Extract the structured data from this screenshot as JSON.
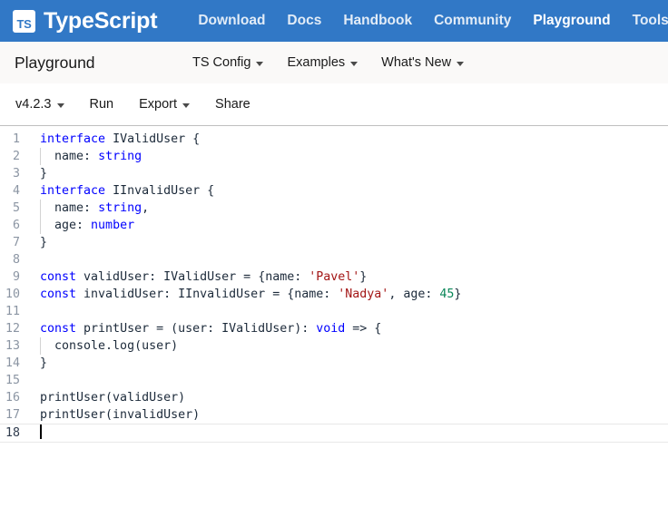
{
  "topnav": {
    "logo_text": "TS",
    "brand": "TypeScript",
    "links": [
      {
        "label": "Download",
        "active": false
      },
      {
        "label": "Docs",
        "active": false
      },
      {
        "label": "Handbook",
        "active": false
      },
      {
        "label": "Community",
        "active": false
      },
      {
        "label": "Playground",
        "active": true
      },
      {
        "label": "Tools",
        "active": false
      }
    ]
  },
  "subheader": {
    "title": "Playground",
    "menus": [
      {
        "label": "TS Config",
        "has_caret": true
      },
      {
        "label": "Examples",
        "has_caret": true
      },
      {
        "label": "What's New",
        "has_caret": true
      }
    ]
  },
  "toolbar": {
    "items": [
      {
        "label": "v4.2.3",
        "has_caret": true
      },
      {
        "label": "Run",
        "has_caret": false
      },
      {
        "label": "Export",
        "has_caret": true
      },
      {
        "label": "Share",
        "has_caret": false
      }
    ]
  },
  "editor": {
    "language": "typescript",
    "current_line": 18,
    "total_lines": 18,
    "lines": [
      {
        "n": 1,
        "indent": false,
        "tokens": [
          {
            "t": "interface",
            "c": "kw"
          },
          {
            "t": " ",
            "c": "plain"
          },
          {
            "t": "IValidUser",
            "c": "tname"
          },
          {
            "t": " {",
            "c": "plain"
          }
        ]
      },
      {
        "n": 2,
        "indent": true,
        "tokens": [
          {
            "t": "  name",
            "c": "plain"
          },
          {
            "t": ": ",
            "c": "plain"
          },
          {
            "t": "string",
            "c": "kw"
          }
        ]
      },
      {
        "n": 3,
        "indent": false,
        "tokens": [
          {
            "t": "}",
            "c": "plain"
          }
        ]
      },
      {
        "n": 4,
        "indent": false,
        "tokens": [
          {
            "t": "interface",
            "c": "kw"
          },
          {
            "t": " ",
            "c": "plain"
          },
          {
            "t": "IInvalidUser",
            "c": "tname"
          },
          {
            "t": " {",
            "c": "plain"
          }
        ]
      },
      {
        "n": 5,
        "indent": true,
        "tokens": [
          {
            "t": "  name",
            "c": "plain"
          },
          {
            "t": ": ",
            "c": "plain"
          },
          {
            "t": "string",
            "c": "kw"
          },
          {
            "t": ",",
            "c": "plain"
          }
        ]
      },
      {
        "n": 6,
        "indent": true,
        "tokens": [
          {
            "t": "  age",
            "c": "plain"
          },
          {
            "t": ": ",
            "c": "plain"
          },
          {
            "t": "number",
            "c": "kw"
          }
        ]
      },
      {
        "n": 7,
        "indent": false,
        "tokens": [
          {
            "t": "}",
            "c": "plain"
          }
        ]
      },
      {
        "n": 8,
        "indent": false,
        "tokens": []
      },
      {
        "n": 9,
        "indent": false,
        "tokens": [
          {
            "t": "const",
            "c": "kw"
          },
          {
            "t": " validUser",
            "c": "plain"
          },
          {
            "t": ": ",
            "c": "plain"
          },
          {
            "t": "IValidUser",
            "c": "tname"
          },
          {
            "t": " = {name: ",
            "c": "plain"
          },
          {
            "t": "'Pavel'",
            "c": "str"
          },
          {
            "t": "}",
            "c": "plain"
          }
        ]
      },
      {
        "n": 10,
        "indent": false,
        "tokens": [
          {
            "t": "const",
            "c": "kw"
          },
          {
            "t": " invalidUser",
            "c": "plain"
          },
          {
            "t": ": ",
            "c": "plain"
          },
          {
            "t": "IInvalidUser",
            "c": "tname"
          },
          {
            "t": " = {name: ",
            "c": "plain"
          },
          {
            "t": "'Nadya'",
            "c": "str"
          },
          {
            "t": ", age: ",
            "c": "plain"
          },
          {
            "t": "45",
            "c": "num"
          },
          {
            "t": "}",
            "c": "plain"
          }
        ]
      },
      {
        "n": 11,
        "indent": false,
        "tokens": []
      },
      {
        "n": 12,
        "indent": false,
        "tokens": [
          {
            "t": "const",
            "c": "kw"
          },
          {
            "t": " printUser = (user",
            "c": "plain"
          },
          {
            "t": ": ",
            "c": "plain"
          },
          {
            "t": "IValidUser",
            "c": "tname"
          },
          {
            "t": "): ",
            "c": "plain"
          },
          {
            "t": "void",
            "c": "kw"
          },
          {
            "t": " => {",
            "c": "plain"
          }
        ]
      },
      {
        "n": 13,
        "indent": true,
        "tokens": [
          {
            "t": "  console.log(user)",
            "c": "plain"
          }
        ]
      },
      {
        "n": 14,
        "indent": false,
        "tokens": [
          {
            "t": "}",
            "c": "plain"
          }
        ]
      },
      {
        "n": 15,
        "indent": false,
        "tokens": []
      },
      {
        "n": 16,
        "indent": false,
        "tokens": [
          {
            "t": "printUser(validUser)",
            "c": "plain"
          }
        ]
      },
      {
        "n": 17,
        "indent": false,
        "tokens": [
          {
            "t": "printUser(invalidUser)",
            "c": "plain"
          }
        ]
      },
      {
        "n": 18,
        "indent": false,
        "tokens": [],
        "cursor": true
      }
    ]
  },
  "colors": {
    "brand_blue": "#3178c6",
    "subheader_bg": "#faf9f8",
    "keyword": "#0000ff",
    "type_name": "#1c2a3a",
    "string": "#a31515",
    "number": "#098658",
    "gutter_text": "#8b95a3"
  }
}
